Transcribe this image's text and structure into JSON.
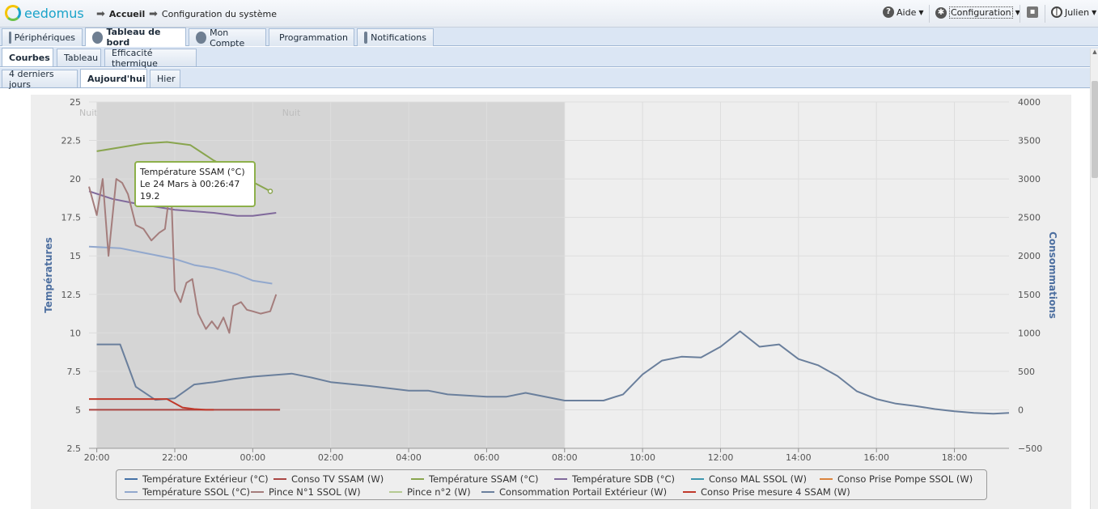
{
  "brand": "eedomus",
  "breadcrumb": {
    "home": "Accueil",
    "current": "Configuration du système"
  },
  "topright": {
    "help": "Aide",
    "config": "Configuration",
    "user": "Julien"
  },
  "main_tabs": [
    "Périphériques",
    "Tableau de bord",
    "Mon Compte",
    "Programmation",
    "Notifications"
  ],
  "sub_tabs": [
    "Courbes",
    "Tableau",
    "Efficacité thermique"
  ],
  "period_tabs": [
    "4 derniers jours",
    "Aujourd'hui",
    "Hier"
  ],
  "tooltip": {
    "title": "Température SSAM (°C)",
    "date": "Le 24 Mars à 00:26:47",
    "value": "19.2"
  },
  "chart_data": {
    "type": "line",
    "ylabel_left": "Températures",
    "ylabel_right": "Consommations",
    "y_left_ticks": [
      "25",
      "22.5",
      "20",
      "17.5",
      "15",
      "12.5",
      "10",
      "7.5",
      "5",
      "2.5"
    ],
    "y_right_ticks": [
      "4000",
      "3500",
      "3000",
      "2500",
      "2000",
      "1500",
      "1000",
      "500",
      "0",
      "−500"
    ],
    "x_ticks": [
      "20:00",
      "22:00",
      "00:00",
      "02:00",
      "04:00",
      "06:00",
      "08:00",
      "10:00",
      "12:00",
      "14:00",
      "16:00",
      "18:00"
    ],
    "band_labels": [
      "Nuit",
      "Nuit"
    ],
    "night_band": {
      "from_h": 20.0,
      "to_h": 32.0
    },
    "ylim_left": [
      2.5,
      25
    ],
    "ylim_right": [
      -500,
      4000
    ],
    "xlim_h": [
      19.8,
      43.4
    ],
    "series": [
      {
        "name": "Température Extérieur (°C)",
        "color": "#4572a7",
        "axis": "left",
        "x": [],
        "y": []
      },
      {
        "name": "Conso TV SSAM (W)",
        "color": "#aa4643",
        "axis": "right",
        "x": [
          19.8,
          20.5,
          21.0,
          21.8,
          22.2,
          22.5,
          23.0,
          24.0,
          24.7
        ],
        "y": [
          0,
          0,
          0,
          0,
          0,
          0,
          0,
          0,
          0
        ]
      },
      {
        "name": "Température SSAM (°C)",
        "color": "#89a54e",
        "axis": "left",
        "x": [
          20.0,
          21.2,
          21.8,
          22.4,
          23.0,
          24.0,
          24.45
        ],
        "y": [
          21.8,
          22.3,
          22.4,
          22.2,
          21.2,
          19.8,
          19.2
        ]
      },
      {
        "name": "Température SDB (°C)",
        "color": "#80699b",
        "axis": "left",
        "x": [
          19.8,
          20.4,
          21.0,
          21.5,
          22.0,
          22.5,
          23.0,
          23.6,
          24.0,
          24.6
        ],
        "y": [
          19.2,
          18.7,
          18.4,
          18.2,
          18.0,
          17.9,
          17.8,
          17.6,
          17.6,
          17.8
        ]
      },
      {
        "name": "Conso MAL SSOL (W)",
        "color": "#3d96ae",
        "axis": "right",
        "x": [],
        "y": []
      },
      {
        "name": "Conso Prise Pompe SSOL (W)",
        "color": "#db843d",
        "axis": "right",
        "x": [],
        "y": []
      },
      {
        "name": "Température SSOL (°C)",
        "color": "#92a8cd",
        "axis": "left",
        "x": [
          19.8,
          20.6,
          21.2,
          22.0,
          22.5,
          23.0,
          23.6,
          24.0,
          24.5
        ],
        "y": [
          15.6,
          15.5,
          15.2,
          14.8,
          14.4,
          14.2,
          13.8,
          13.4,
          13.2
        ]
      },
      {
        "name": "Pince N°1 SSOL (W)",
        "color": "#a47d7c",
        "axis": "right",
        "x": [
          19.8,
          20.0,
          20.15,
          20.3,
          20.5,
          20.65,
          20.8,
          21.0,
          21.2,
          21.4,
          21.6,
          21.75,
          21.9,
          22.0,
          22.15,
          22.3,
          22.45,
          22.6,
          22.8,
          22.95,
          23.1,
          23.25,
          23.4,
          23.5,
          23.7,
          23.85,
          24.0,
          24.2,
          24.45,
          24.6
        ],
        "y": [
          2900,
          2530,
          3000,
          2000,
          3000,
          2950,
          2800,
          2400,
          2350,
          2200,
          2300,
          2350,
          2950,
          1550,
          1400,
          1650,
          1700,
          1250,
          1050,
          1150,
          1050,
          1200,
          1000,
          1350,
          1400,
          1300,
          1280,
          1250,
          1280,
          1500
        ]
      },
      {
        "name": "Pince n°2 (W)",
        "color": "#b5ca92",
        "axis": "right",
        "x": [],
        "y": []
      },
      {
        "name": "Consommation Portail Extérieur (W)",
        "color": "#6a7f9c",
        "axis": "right",
        "x": [
          20.0,
          20.6,
          21.0,
          21.5,
          22.0,
          22.5,
          23.0,
          23.5,
          24.0,
          25.0,
          25.5,
          26.0,
          27.0,
          28.0,
          28.5,
          29.0,
          30.0,
          30.5,
          31.0,
          32.0,
          32.5,
          33.0,
          33.5,
          34.0,
          34.5,
          35.0,
          35.5,
          36.0,
          36.5,
          37.0,
          37.5,
          38.0,
          38.5,
          39.0,
          39.5,
          40.0,
          40.5,
          41.0,
          41.5,
          42.0,
          42.5,
          43.0,
          43.4
        ],
        "y": [
          850,
          850,
          300,
          130,
          150,
          330,
          360,
          400,
          430,
          470,
          420,
          360,
          310,
          250,
          250,
          200,
          170,
          170,
          220,
          120,
          120,
          120,
          200,
          460,
          640,
          690,
          680,
          820,
          1020,
          820,
          850,
          660,
          580,
          440,
          240,
          140,
          80,
          50,
          10,
          -20,
          -40,
          -50,
          -40
        ]
      },
      {
        "name": "Conso Prise mesure 4 SSAM (W)",
        "color": "#c0392b",
        "axis": "right",
        "x": [
          19.8,
          20.5,
          21.0,
          21.5,
          21.8,
          22.2,
          22.5,
          22.8,
          23.0
        ],
        "y": [
          140,
          140,
          140,
          140,
          140,
          30,
          10,
          0,
          0
        ]
      }
    ]
  }
}
